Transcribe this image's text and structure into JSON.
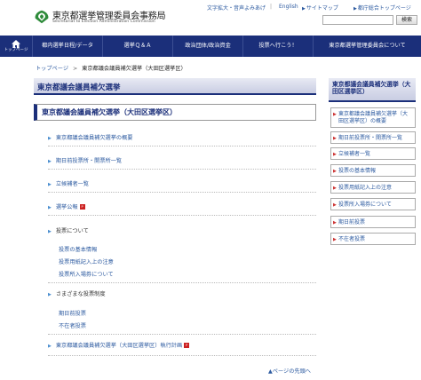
{
  "header": {
    "logo_title": "東京都選挙管理委員会事務局",
    "logo_subtitle": "Secretariat to Election Administration Commission",
    "util_links": [
      "文字拡大・音声よみあげ",
      "English",
      "サイトマップ",
      "都庁総合トップページ"
    ],
    "search_button": "検索"
  },
  "nav": {
    "home_label": "トップページ",
    "items": [
      "都内選挙日程/データ",
      "選挙Ｑ＆Ａ",
      "政治団体/政治資金",
      "投票へ行こう！",
      "東京都選挙管理委員会について"
    ]
  },
  "breadcrumb": {
    "top": "トップページ",
    "separator": ">",
    "current": "東京都議会議員補欠選挙（大田区選挙区）"
  },
  "main": {
    "page_title": "東京都議会議員補欠選挙",
    "section_title": "東京都議会議員補欠選挙（大田区選挙区）",
    "links": [
      "東京都議会議員補欠選挙の概要",
      "期日前投票所・開票所一覧",
      "立候補者一覧",
      "選挙公報"
    ],
    "voting_heading": "投票について",
    "voting_links": [
      "投票の基本情報",
      "投票用紙記入上の注意",
      "投票所入場券について"
    ],
    "system_heading": "さまざまな投票制度",
    "system_links": [
      "期日前投票",
      "不在者投票"
    ],
    "plan_link": "東京都議会議員補欠選挙（大田区選挙区）執行計画",
    "pagetop": "▲ページの先頭へ"
  },
  "sidebar": {
    "heading": "東京都議会議員補欠選挙（大田区選挙区）",
    "items": [
      "東京都議会議員補欠選挙（大田区選挙区）の概要",
      "期日前投票所・開票所一覧",
      "立候補者一覧",
      "投票の基本情報",
      "投票用紙記入上の注意",
      "投票所入場券について",
      "期日前投票",
      "不在者投票"
    ]
  },
  "colors": {
    "brand_navy": "#1b2f7a",
    "link_blue": "#2c5aa0",
    "logo_green": "#2e8b3a"
  }
}
